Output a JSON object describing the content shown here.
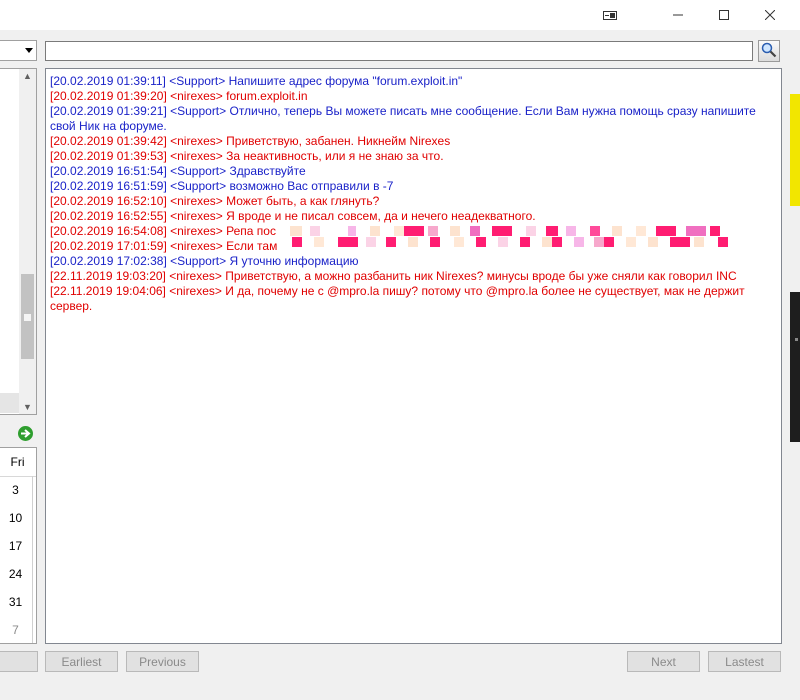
{
  "window": {
    "controls": {
      "restore_icon": "restore-window-icon",
      "minimize_icon": "minimize-icon",
      "maximize_icon": "maximize-icon",
      "close_icon": "close-icon"
    }
  },
  "search": {
    "value": "",
    "placeholder": "",
    "button_icon": "magnifier-icon"
  },
  "calendar": {
    "header": "Fri",
    "days": [
      "3",
      "10",
      "17",
      "24",
      "31",
      "7"
    ]
  },
  "log": {
    "colors": {
      "support": "#1a22c8",
      "user": "#e00000"
    },
    "messages": [
      {
        "role": "support",
        "text": "[20.02.2019 01:39:11] <Support> Напишите адрес форума \"forum.exploit.in\""
      },
      {
        "role": "user",
        "text": "[20.02.2019 01:39:20] <nirexes> forum.exploit.in"
      },
      {
        "role": "support",
        "text": "[20.02.2019 01:39:21] <Support> Отлично, теперь Вы можете писать мне сообщение. Если Вам нужна помощь сразу напишите свой Ник на форуме."
      },
      {
        "role": "user",
        "text": "[20.02.2019 01:39:42] <nirexes> Приветствую, забанен. Никнейм Nirexes"
      },
      {
        "role": "user",
        "text": "[20.02.2019 01:39:53] <nirexes> За неактивность, или я не знаю за что."
      },
      {
        "role": "support",
        "text": "[20.02.2019 16:51:54] <Support> Здравствуйте"
      },
      {
        "role": "support",
        "text": "[20.02.2019 16:51:59] <Support> возможно Вас отправили в -7"
      },
      {
        "role": "user",
        "text": "[20.02.2019 16:52:10] <nirexes> Может быть, а как глянуть?"
      },
      {
        "role": "user",
        "text": "[20.02.2019 16:52:55] <nirexes> Я вроде и не писал совсем, да и нечего неадекватного."
      },
      {
        "role": "user",
        "text": "[20.02.2019 16:54:08] <nirexes> Репа пос"
      },
      {
        "role": "user",
        "text": "[20.02.2019 17:01:59] <nirexes> Если там"
      },
      {
        "role": "support",
        "text": "[20.02.2019 17:02:38] <Support> Я уточню информацию"
      },
      {
        "role": "user",
        "text": "[22.11.2019 19:03:20] <nirexes> Приветствую, а можно разбанить ник Nirexes? минусы вроде бы уже сняли как говорил INC"
      },
      {
        "role": "user",
        "text": "[22.11.2019 19:04:06] <nirexes> И да, почему не с @mpro.la пишу? потому что @mpro.la более не существует, мак не держит сервер."
      }
    ]
  },
  "buttons": {
    "earliest": "Earliest",
    "previous": "Previous",
    "next": "Next",
    "lastest": "Lastest"
  },
  "go_icon": "go-arrow-icon"
}
